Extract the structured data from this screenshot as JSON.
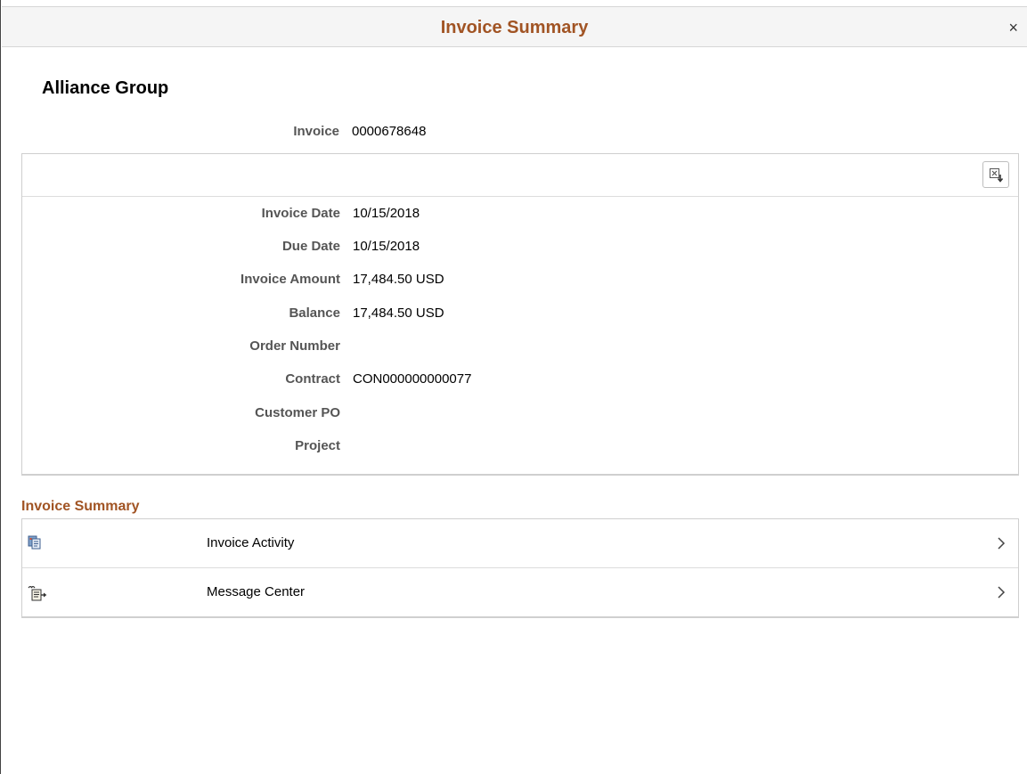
{
  "header": {
    "title": "Invoice Summary",
    "close_symbol": "×"
  },
  "customer": {
    "name": "Alliance Group"
  },
  "invoice": {
    "label": "Invoice",
    "value": "0000678648"
  },
  "toolbar": {
    "export_icon": "excel-export-icon"
  },
  "fields": [
    {
      "label": "Invoice Date",
      "value": "10/15/2018"
    },
    {
      "label": "Due Date",
      "value": "10/15/2018"
    },
    {
      "label": "Invoice Amount",
      "value": "17,484.50 USD"
    },
    {
      "label": "Balance",
      "value": "17,484.50 USD"
    },
    {
      "label": "Order Number",
      "value": ""
    },
    {
      "label": "Contract",
      "value": "CON000000000077"
    },
    {
      "label": "Customer PO",
      "value": ""
    },
    {
      "label": "Project",
      "value": ""
    }
  ],
  "summary_section": {
    "title": "Invoice Summary",
    "items": [
      {
        "label": "Invoice Activity",
        "icon": "invoice-activity-icon"
      },
      {
        "label": "Message Center",
        "icon": "message-center-icon"
      }
    ]
  },
  "colors": {
    "accent": "#a15424",
    "label_gray": "#555555",
    "border": "#cfcfcf"
  }
}
